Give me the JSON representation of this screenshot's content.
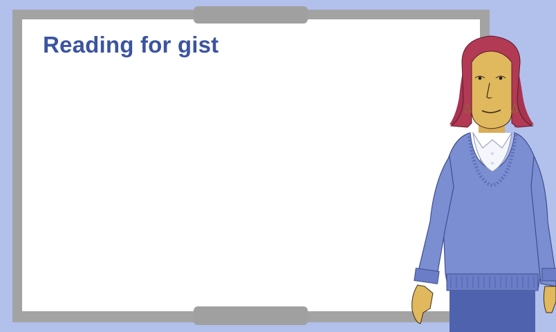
{
  "board": {
    "title": "Reading for gist",
    "title_color": "#3b54a0"
  },
  "colors": {
    "background": "#b2c0ec",
    "frame": "#a3a3a3",
    "board_surface": "#ffffff",
    "sweater": "#7b8ed2",
    "skirt": "#4e62ae",
    "hair": "#b23a55",
    "skin": "#e0b85e"
  },
  "character": {
    "icon": "teacher-illustration"
  }
}
